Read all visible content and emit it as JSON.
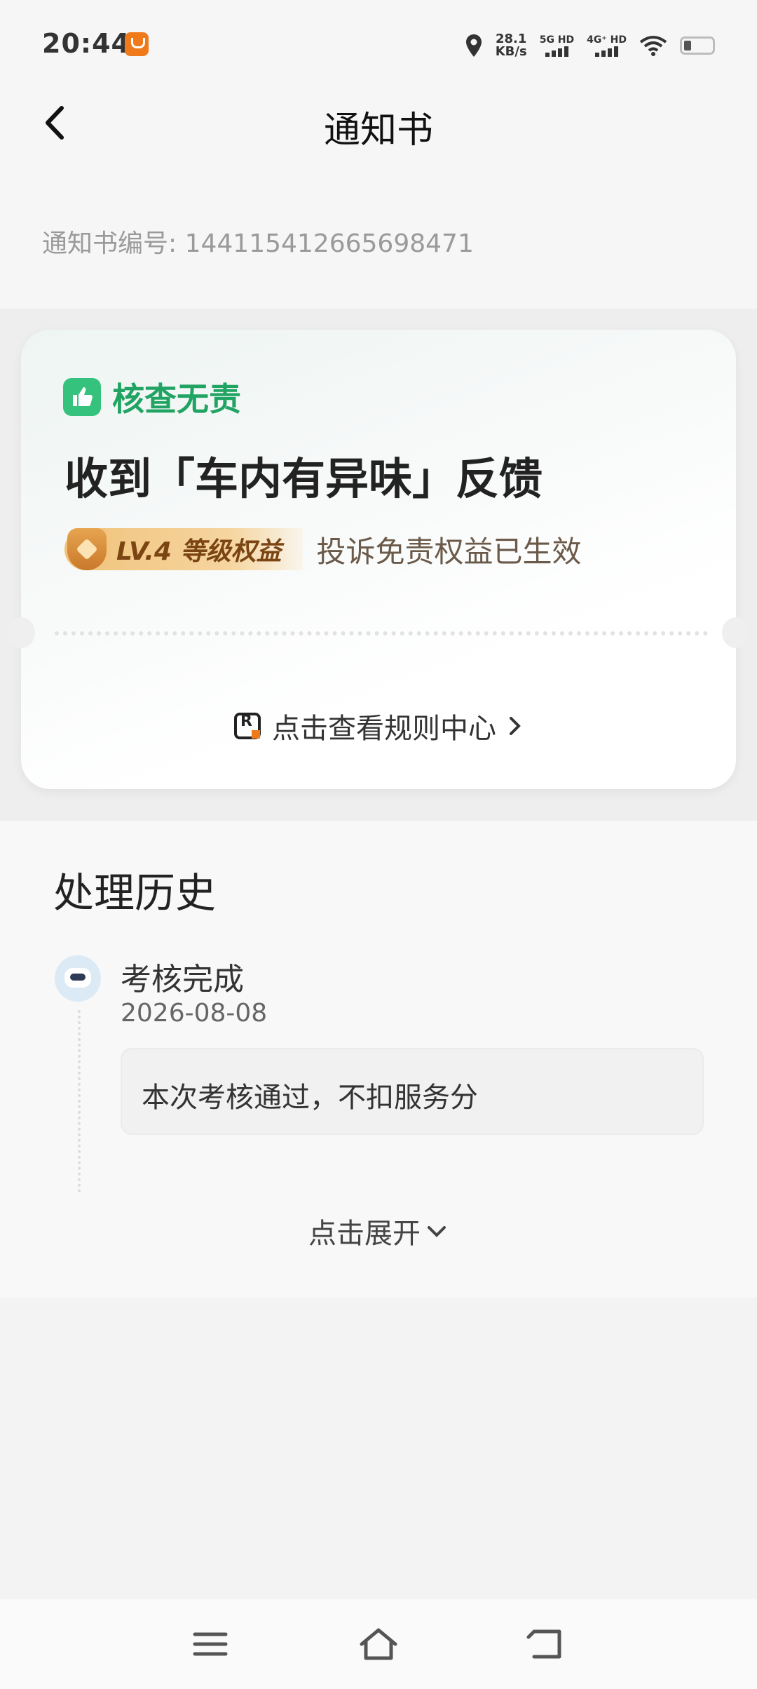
{
  "status_bar": {
    "time": "20:44",
    "network_speed": "28.1",
    "network_speed_unit": "KB/s",
    "sim1_label": "5G HD",
    "sim2_label": "4G⁺ HD"
  },
  "header": {
    "title": "通知书",
    "back_icon": "chevron-left-icon"
  },
  "notice": {
    "number_label": "通知书编号: 1441154126656984​71"
  },
  "result_card": {
    "tag_label": "核查无责",
    "tag_icon": "thumbs-up-icon",
    "headline": "收到「车内有异味」反馈",
    "level_badge": "LV.4 等级权益",
    "benefit_text": "投诉免责权益已生效",
    "rule_link": "点击查看规则中心",
    "accent_color": "#21a463"
  },
  "history": {
    "title": "处理历史",
    "entries": [
      {
        "status": "考核完成",
        "date": "2026-08-08",
        "detail": "本次考核通过，不扣服务分"
      }
    ],
    "expand_label": "点击展开"
  },
  "nav_bar": {
    "buttons": [
      "menu-icon",
      "home-icon",
      "back-icon"
    ]
  }
}
